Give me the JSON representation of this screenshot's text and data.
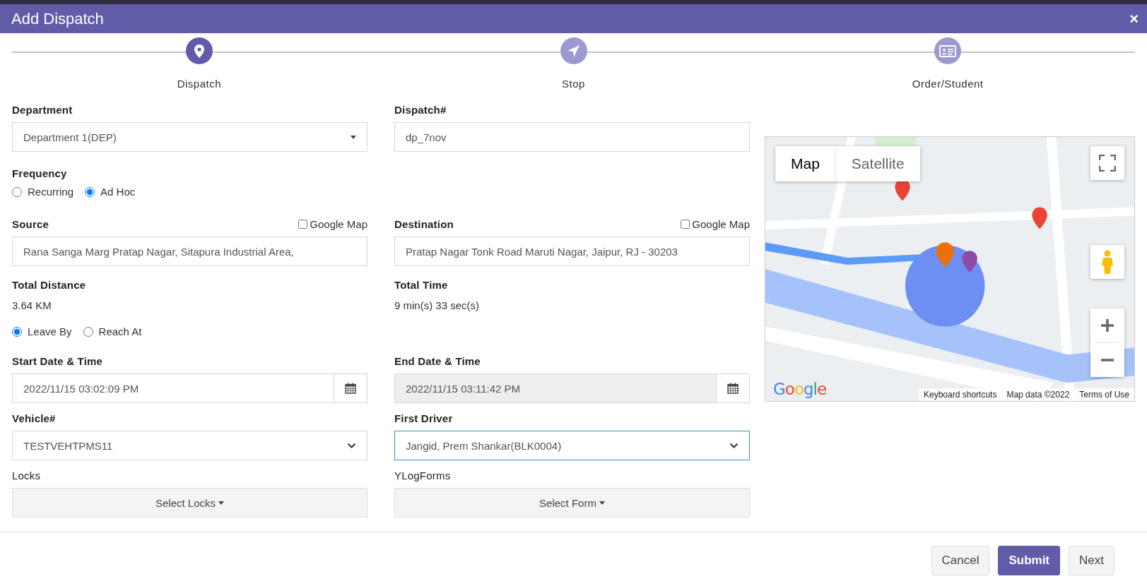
{
  "dialog": {
    "title": "Add Dispatch",
    "close": "×"
  },
  "steps": [
    {
      "label": "Dispatch",
      "selected": true
    },
    {
      "label": "Stop",
      "selected": false
    },
    {
      "label": "Order/Student",
      "selected": false
    }
  ],
  "department": {
    "label": "Department",
    "value": "Department 1(DEP)"
  },
  "dispatch_number": {
    "label": "Dispatch#",
    "value": "dp_7nov"
  },
  "frequency": {
    "label": "Frequency",
    "options": [
      {
        "label": "Recurring",
        "selected": false
      },
      {
        "label": "Ad Hoc",
        "selected": true
      }
    ]
  },
  "source": {
    "label": "Source",
    "google_map": {
      "label": "Google Map",
      "checked": false
    },
    "value": "Rana Sanga Marg Pratap Nagar, Sitapura Industrial Area,"
  },
  "destination": {
    "label": "Destination",
    "google_map": {
      "label": "Google Map",
      "checked": false
    },
    "value": "Pratap Nagar Tonk Road Maruti Nagar, Jaipur, RJ - 30203"
  },
  "total_distance": {
    "label": "Total Distance",
    "value": "3.64 KM"
  },
  "total_time": {
    "label": "Total Time",
    "value": "9 min(s) 33 sec(s)"
  },
  "timing": [
    {
      "label": "Leave By",
      "selected": true
    },
    {
      "label": "Reach At",
      "selected": false
    }
  ],
  "start": {
    "label": "Start Date & Time",
    "value": "2022/11/15 03:02:09 PM",
    "disabled": false
  },
  "end": {
    "label": "End Date & Time",
    "value": "2022/11/15 03:11:42 PM",
    "disabled": true
  },
  "vehicle": {
    "label": "Vehicle#",
    "value": "TESTVEHTPMS11",
    "focused": false
  },
  "first_driver": {
    "label": "First Driver",
    "value": "Jangid, Prem Shankar(BLK0004)",
    "focused": true
  },
  "locks": {
    "label": "Locks",
    "button": "Select Locks"
  },
  "forms": {
    "label": "YLogForms",
    "button": "Select Form"
  },
  "map": {
    "types": [
      {
        "label": "Map",
        "selected": true
      },
      {
        "label": "Satellite",
        "selected": false
      }
    ],
    "logo": "Google",
    "attribution": [
      "Keyboard shortcuts",
      "Map data ©2022",
      "Terms of Use"
    ]
  },
  "buttons": [
    {
      "label": "Cancel",
      "kind": "default"
    },
    {
      "label": "Submit",
      "kind": "primary"
    },
    {
      "label": "Next",
      "kind": "default"
    }
  ]
}
